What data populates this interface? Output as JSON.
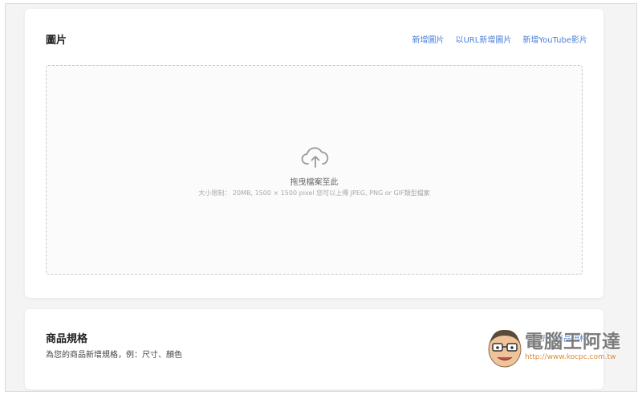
{
  "images_section": {
    "title": "圖片",
    "actions": [
      {
        "label": "新增圖片"
      },
      {
        "label": "以URL新增圖片"
      },
      {
        "label": "新增YouTube影片"
      }
    ],
    "dropzone": {
      "icon": "cloud-upload-icon",
      "text": "拖曳檔案至此",
      "hint": "大小限制： 20MB, 1500 × 1500 pixel 您可以上傳 JPEG, PNG or GIF類型檔案"
    }
  },
  "specs_section": {
    "title": "商品規格",
    "subtitle": "為您的商品新增規格，例：尺寸、顏色",
    "action_label": "新增商品規格"
  },
  "watermark": {
    "title": "電腦王阿達",
    "url": "http://www.kocpc.com.tw"
  },
  "colors": {
    "link": "#4a7fd6",
    "background": "#f4f4f5",
    "card": "#ffffff",
    "dropzone_border": "#c8c8c8",
    "watermark_url": "#e08a3a"
  }
}
